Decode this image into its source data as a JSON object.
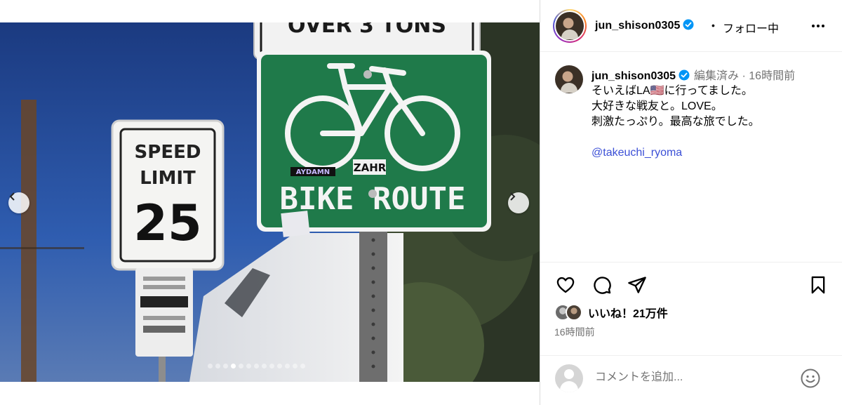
{
  "post": {
    "username": "jun_shison0305",
    "follow_separator": "•",
    "follow_status": "フォロー中",
    "more_icon": "more-horizontal-icon"
  },
  "caption": {
    "username": "jun_shison0305",
    "meta": "編集済み · 16時間前",
    "text": "そいえばLA🇺🇸に行ってました。\n大好きな戦友と。LOVE。\n刺激たっぷり。最高な旅でした。",
    "mention": "@takeuchi_ryoma"
  },
  "actions": {
    "like_icon": "heart-icon",
    "comment_icon": "comment-icon",
    "share_icon": "share-icon",
    "save_icon": "bookmark-icon"
  },
  "likes": {
    "text": "いいね！21万件"
  },
  "timestamp": "16時間前",
  "comment": {
    "placeholder": "コメントを追加...",
    "emoji_icon": "emoji-icon"
  },
  "carousel": {
    "slide_count": 13,
    "active_index": 3
  },
  "photo_text": {
    "speed_sign_line1": "SPEED",
    "speed_sign_line2": "LIMIT",
    "speed_sign_value": "25",
    "bike_sign_text": "BIKE ROUTE",
    "sticker_1": "AYDAMN",
    "sticker_2": "ZAHR",
    "top_sign_partial": "OVER 3 TONS"
  },
  "colors": {
    "accent_blue": "#0095f6",
    "mention_blue": "#3b4fd6",
    "bike_sign_green": "#1f7a4a",
    "secondary_text": "#737373"
  }
}
